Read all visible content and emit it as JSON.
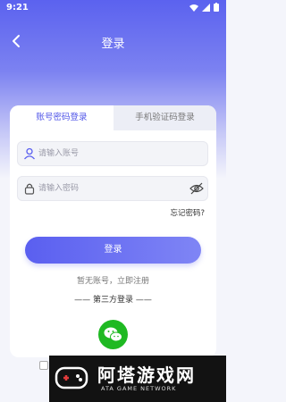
{
  "status_bar": {
    "time": "9:21"
  },
  "header": {
    "title": "登录"
  },
  "tabs": [
    {
      "label": "账号密码登录",
      "active": true
    },
    {
      "label": "手机验证码登录",
      "active": false
    }
  ],
  "form": {
    "account_placeholder": "请输入账号",
    "password_placeholder": "请输入密码",
    "forgot_password": "忘记密码?",
    "login_button": "登录",
    "register_link": "暂无账号，立即注册",
    "third_party_label": "—— 第三方登录 ——"
  },
  "watermark": {
    "title": "阿塔游戏网",
    "subtitle": "ATA GAME NETWORK"
  },
  "colors": {
    "accent": "#4f54e8",
    "wechat": "#1fb922"
  },
  "icons": [
    "back-icon",
    "user-icon",
    "lock-icon",
    "eye-off-icon",
    "wechat-icon",
    "wifi-icon",
    "signal-icon",
    "battery-icon"
  ]
}
